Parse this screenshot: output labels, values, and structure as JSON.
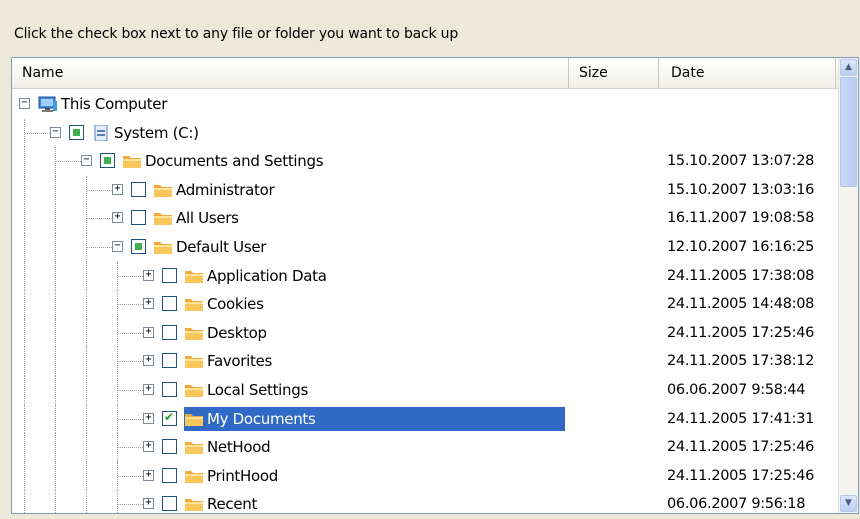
{
  "instruction": "Click the check box next to any file or folder you want to back up",
  "columns": {
    "name": "Name",
    "size": "Size",
    "date": "Date"
  },
  "colors": {
    "selection": "#316ac5",
    "check": "#21a121",
    "partial": "#3fb34f",
    "folder": "#f7b731"
  },
  "tree": [
    {
      "label": "This Computer",
      "date": "",
      "depth": 0,
      "expanded": true,
      "checkbox": "none",
      "icon": "computer-icon",
      "selected": false
    },
    {
      "label": "System (C:)",
      "date": "",
      "depth": 1,
      "expanded": true,
      "checkbox": "partial",
      "icon": "drive-icon",
      "selected": false
    },
    {
      "label": "Documents and Settings",
      "date": "15.10.2007 13:07:28",
      "depth": 2,
      "expanded": true,
      "checkbox": "partial",
      "icon": "folder-icon",
      "selected": false
    },
    {
      "label": "Administrator",
      "date": "15.10.2007 13:03:16",
      "depth": 3,
      "expanded": false,
      "checkbox": "unchecked",
      "icon": "folder-icon",
      "selected": false
    },
    {
      "label": "All Users",
      "date": "16.11.2007 19:08:58",
      "depth": 3,
      "expanded": false,
      "checkbox": "unchecked",
      "icon": "folder-icon",
      "selected": false
    },
    {
      "label": "Default User",
      "date": "12.10.2007 16:16:25",
      "depth": 3,
      "expanded": true,
      "checkbox": "partial",
      "icon": "folder-icon",
      "selected": false
    },
    {
      "label": "Application Data",
      "date": "24.11.2005 17:38:08",
      "depth": 4,
      "expanded": false,
      "checkbox": "unchecked",
      "icon": "folder-icon",
      "selected": false
    },
    {
      "label": "Cookies",
      "date": "24.11.2005 14:48:08",
      "depth": 4,
      "expanded": false,
      "checkbox": "unchecked",
      "icon": "folder-icon",
      "selected": false
    },
    {
      "label": "Desktop",
      "date": "24.11.2005 17:25:46",
      "depth": 4,
      "expanded": false,
      "checkbox": "unchecked",
      "icon": "folder-icon",
      "selected": false
    },
    {
      "label": "Favorites",
      "date": "24.11.2005 17:38:12",
      "depth": 4,
      "expanded": false,
      "checkbox": "unchecked",
      "icon": "folder-icon",
      "selected": false
    },
    {
      "label": "Local Settings",
      "date": "06.06.2007 9:58:44",
      "depth": 4,
      "expanded": false,
      "checkbox": "unchecked",
      "icon": "folder-icon",
      "selected": false
    },
    {
      "label": "My Documents",
      "date": "24.11.2005 17:41:31",
      "depth": 4,
      "expanded": false,
      "checkbox": "checked",
      "icon": "folder-icon",
      "selected": true
    },
    {
      "label": "NetHood",
      "date": "24.11.2005 17:25:46",
      "depth": 4,
      "expanded": false,
      "checkbox": "unchecked",
      "icon": "folder-icon",
      "selected": false
    },
    {
      "label": "PrintHood",
      "date": "24.11.2005 17:25:46",
      "depth": 4,
      "expanded": false,
      "checkbox": "unchecked",
      "icon": "folder-icon",
      "selected": false
    },
    {
      "label": "Recent",
      "date": "06.06.2007 9:56:18",
      "depth": 4,
      "expanded": false,
      "checkbox": "unchecked",
      "icon": "folder-icon",
      "selected": false
    }
  ],
  "scrollbar": {
    "up_glyph": "▲",
    "down_glyph": "▼"
  }
}
